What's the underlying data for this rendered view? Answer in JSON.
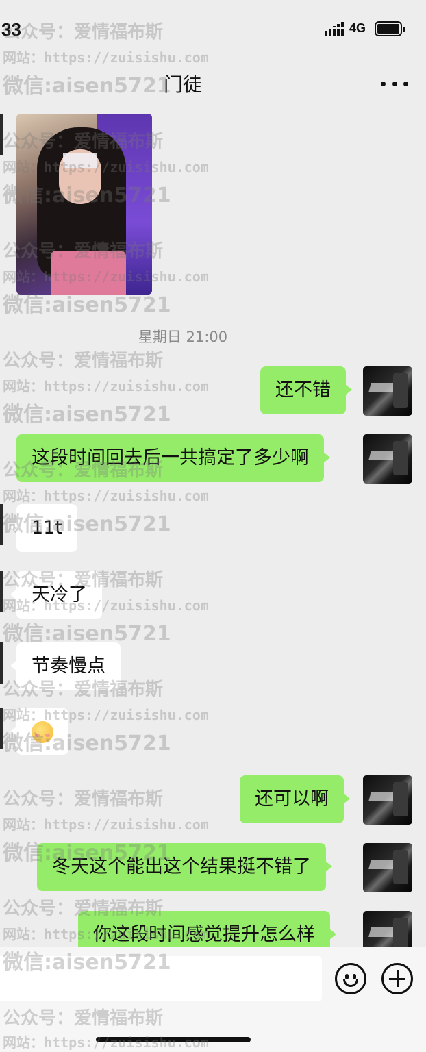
{
  "status_bar": {
    "time": "33",
    "network": "4G"
  },
  "header": {
    "title": "门徒"
  },
  "chat": {
    "timestamp": "星期日 21:00",
    "messages": [
      {
        "side": "out",
        "text": "还不错"
      },
      {
        "side": "out",
        "text": "这段时间回去后一共搞定了多少啊"
      },
      {
        "side": "in",
        "text": "11t"
      },
      {
        "side": "in",
        "text": "天冷了"
      },
      {
        "side": "in",
        "text": "节奏慢点"
      },
      {
        "side": "in",
        "emoji": "blushing-face"
      },
      {
        "side": "out",
        "text": "还可以啊"
      },
      {
        "side": "out",
        "text": "冬天这个能出这个结果挺不错了"
      },
      {
        "side": "out",
        "text": "你这段时间感觉提升怎么样"
      }
    ]
  },
  "input": {
    "value": ""
  },
  "watermark": {
    "line1": "公众号：爱情福布斯",
    "line2": "网站：https://zuisishu.com",
    "line3": "微信:aisen5721"
  },
  "colors": {
    "outgoing_bubble": "#95ec69",
    "incoming_bubble": "#ffffff",
    "background": "#ededed"
  }
}
